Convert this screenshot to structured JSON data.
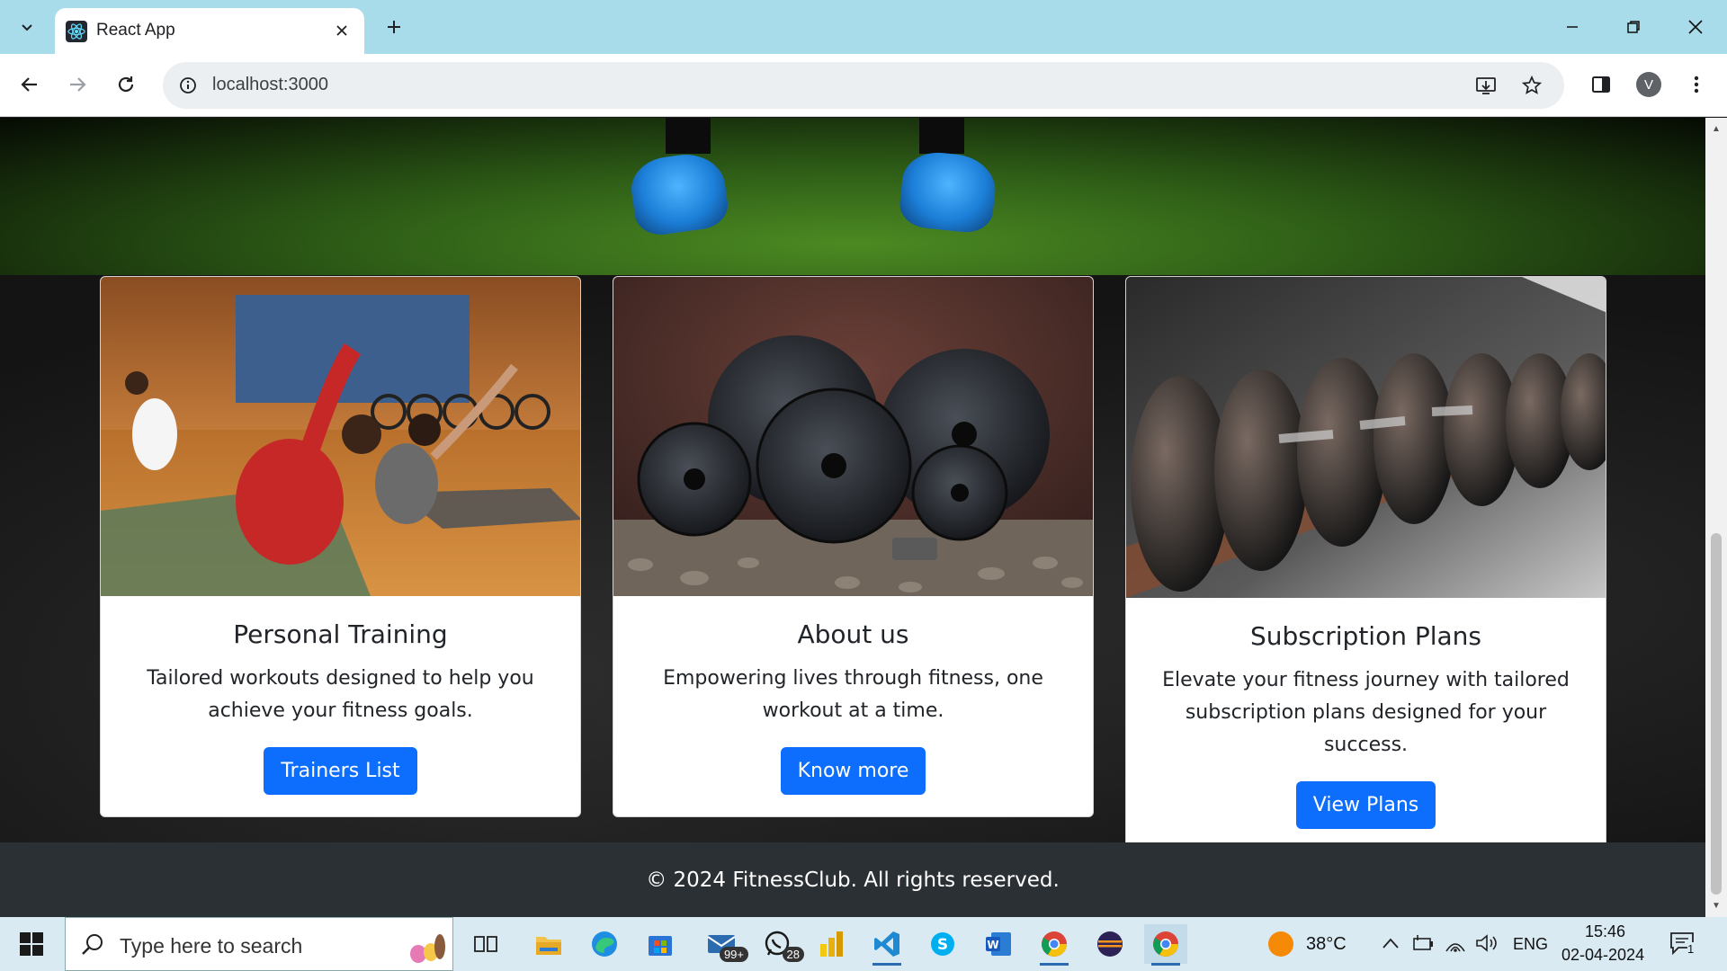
{
  "browser": {
    "tab_title": "React App",
    "url": "localhost:3000",
    "profile_initial": "V"
  },
  "cards": [
    {
      "title": "Personal Training",
      "text_line1": "Tailored workouts designed to help you",
      "text_line2": "achieve your fitness goals.",
      "button": "Trainers List"
    },
    {
      "title": "About us",
      "text_line1": "Empowering lives through fitness, one",
      "text_line2": "workout at a time.",
      "button": "Know more"
    },
    {
      "title": "Subscription Plans",
      "text_line1": "Elevate your fitness journey with tailored",
      "text_line2": "subscription plans designed for your success.",
      "button": "View Plans"
    }
  ],
  "footer": {
    "text": "© 2024 FitnessClub. All rights reserved."
  },
  "taskbar": {
    "search_placeholder": "Type here to search",
    "mail_badge": "99+",
    "whatsapp_badge": "28",
    "weather_temp": "38°C",
    "language": "ENG",
    "time": "15:46",
    "date": "02-04-2024",
    "notification_count": "1"
  },
  "colors": {
    "primary_button": "#0d6efd",
    "footer_bg": "#2b3035",
    "titlebar_bg": "#a8dcea"
  }
}
